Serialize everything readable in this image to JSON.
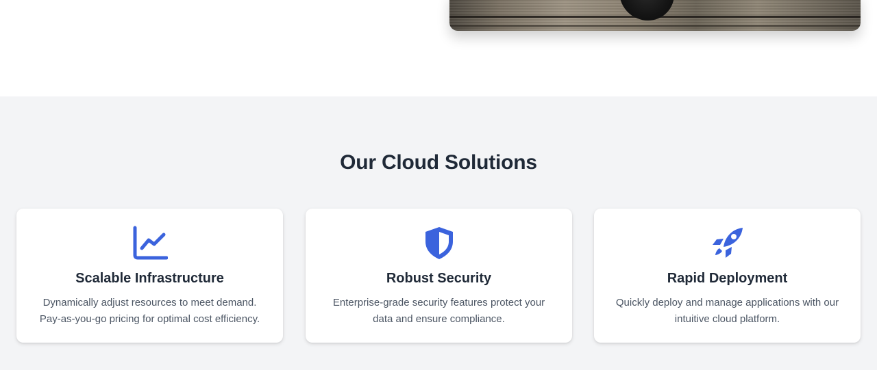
{
  "section": {
    "title": "Our Cloud Solutions"
  },
  "colors": {
    "accent": "#3b63dd",
    "section_bg": "#f3f4f6",
    "heading": "#1f2937",
    "body_text": "#4b5563"
  },
  "cards": [
    {
      "icon": "chart-line-icon",
      "title": "Scalable Infrastructure",
      "desc_lines": [
        "Dynamically adjust resources to meet demand.",
        "Pay-as-you-go pricing for optimal cost efficiency."
      ]
    },
    {
      "icon": "shield-icon",
      "title": "Robust Security",
      "desc_lines": [
        "Enterprise-grade security features protect your",
        "data and ensure compliance."
      ]
    },
    {
      "icon": "rocket-icon",
      "title": "Rapid Deployment",
      "desc_lines": [
        "Quickly deploy and manage applications with our",
        "intuitive cloud platform."
      ]
    }
  ]
}
